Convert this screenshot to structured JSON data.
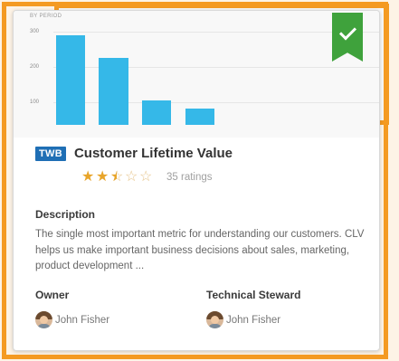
{
  "chart": {
    "title": "BY PERIOD",
    "ticks": [
      "300",
      "200",
      "100"
    ],
    "bar_values": [
      255,
      190,
      70,
      45
    ],
    "bar_color": "#35b8e8"
  },
  "certified_badge": {
    "icon": "check-icon",
    "color": "#3fa23c"
  },
  "card": {
    "type_badge": "TWB",
    "title": "Customer Lifetime Value",
    "rating": 2.5,
    "rating_max": 5,
    "ratings_count": "35 ratings",
    "description_label": "Description",
    "description": "The single most important metric for understanding our customers. CLV helps us make important business decisions about sales, marketing, product development ...",
    "owner_label": "Owner",
    "owner_name": "John Fisher",
    "steward_label": "Technical Steward",
    "steward_name": "John Fisher"
  },
  "colors": {
    "accent_frame": "#f49a22",
    "badge_blue": "#1f6fb5",
    "star": "#e8a52a"
  }
}
